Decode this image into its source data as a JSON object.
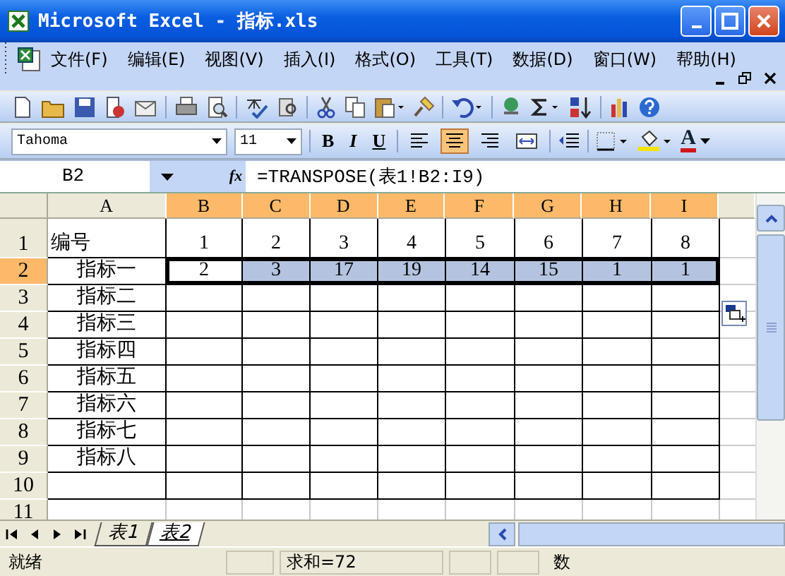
{
  "window": {
    "title": "Microsoft Excel - 指标.xls"
  },
  "menu": [
    "文件(F)",
    "编辑(E)",
    "视图(V)",
    "插入(I)",
    "格式(O)",
    "工具(T)",
    "数据(D)",
    "窗口(W)",
    "帮助(H)"
  ],
  "format_bar": {
    "font": "Tahoma",
    "size": "11",
    "styles": [
      "B",
      "I",
      "U"
    ],
    "align": [
      {
        "kind": "left",
        "selected": false
      },
      {
        "kind": "center",
        "selected": true
      },
      {
        "kind": "right",
        "selected": false
      },
      {
        "kind": "merge",
        "selected": false
      }
    ],
    "font_color": "A"
  },
  "formula_bar": {
    "cell": "B2",
    "fx": "fx",
    "formula": "=TRANSPOSE(表1!B2:I9)"
  },
  "sheet": {
    "columns": [
      {
        "label": "A",
        "selected": false
      },
      {
        "label": "B",
        "selected": true
      },
      {
        "label": "C",
        "selected": true
      },
      {
        "label": "D",
        "selected": true
      },
      {
        "label": "E",
        "selected": true
      },
      {
        "label": "F",
        "selected": true
      },
      {
        "label": "G",
        "selected": true
      },
      {
        "label": "H",
        "selected": true
      },
      {
        "label": "I",
        "selected": true
      }
    ],
    "rows": [
      {
        "header": "1",
        "selected": false,
        "cells": [
          {
            "text": "编号"
          },
          {
            "text": "1"
          },
          {
            "text": "2"
          },
          {
            "text": "3"
          },
          {
            "text": "4"
          },
          {
            "text": "5"
          },
          {
            "text": "6"
          },
          {
            "text": "7"
          },
          {
            "text": "8"
          }
        ]
      },
      {
        "header": "2",
        "selected": true,
        "cells": [
          {
            "text": "指标一"
          },
          {
            "text": "2",
            "active": true
          },
          {
            "text": "3",
            "selected": true
          },
          {
            "text": "17",
            "selected": true
          },
          {
            "text": "19",
            "selected": true
          },
          {
            "text": "14",
            "selected": true
          },
          {
            "text": "15",
            "selected": true
          },
          {
            "text": "1",
            "selected": true
          },
          {
            "text": "1",
            "selected": true
          }
        ]
      },
      {
        "header": "3",
        "selected": false,
        "cells": [
          {
            "text": "指标二"
          }
        ]
      },
      {
        "header": "4",
        "selected": false,
        "cells": [
          {
            "text": "指标三"
          }
        ]
      },
      {
        "header": "5",
        "selected": false,
        "cells": [
          {
            "text": "指标四"
          }
        ]
      },
      {
        "header": "6",
        "selected": false,
        "cells": [
          {
            "text": "指标五"
          }
        ]
      },
      {
        "header": "7",
        "selected": false,
        "cells": [
          {
            "text": "指标六"
          }
        ]
      },
      {
        "header": "8",
        "selected": false,
        "cells": [
          {
            "text": "指标七"
          }
        ]
      },
      {
        "header": "9",
        "selected": false,
        "cells": [
          {
            "text": "指标八"
          }
        ]
      },
      {
        "header": "10",
        "selected": false,
        "cells": []
      },
      {
        "header": "11",
        "selected": false,
        "cells": []
      }
    ]
  },
  "sheet_tabs": [
    {
      "label": "表1",
      "selected": false
    },
    {
      "label": "表2",
      "selected": true
    }
  ],
  "status_bar": {
    "state": "就绪",
    "sum": "求和=72",
    "mode": "数"
  }
}
